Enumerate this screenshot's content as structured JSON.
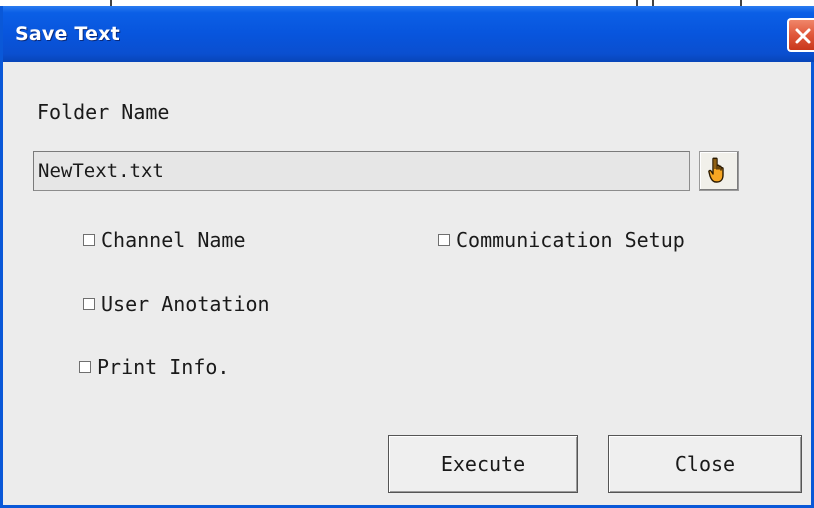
{
  "window": {
    "title": "Save Text"
  },
  "folder": {
    "label": "Folder Name",
    "value": "NewText.txt",
    "browse_icon": "pointing-hand-icon"
  },
  "options": {
    "channel_name": {
      "label": "Channel Name",
      "checked": false
    },
    "communication_setup": {
      "label": "Communication Setup",
      "checked": false
    },
    "user_anotation": {
      "label": "User Anotation",
      "checked": false
    },
    "print_info": {
      "label": "Print Info.",
      "checked": false
    }
  },
  "buttons": {
    "execute": "Execute",
    "close": "Close"
  },
  "colors": {
    "titlebar": "#0855dd",
    "dialog_background": "#ececec",
    "close_button": "#e0573a"
  }
}
